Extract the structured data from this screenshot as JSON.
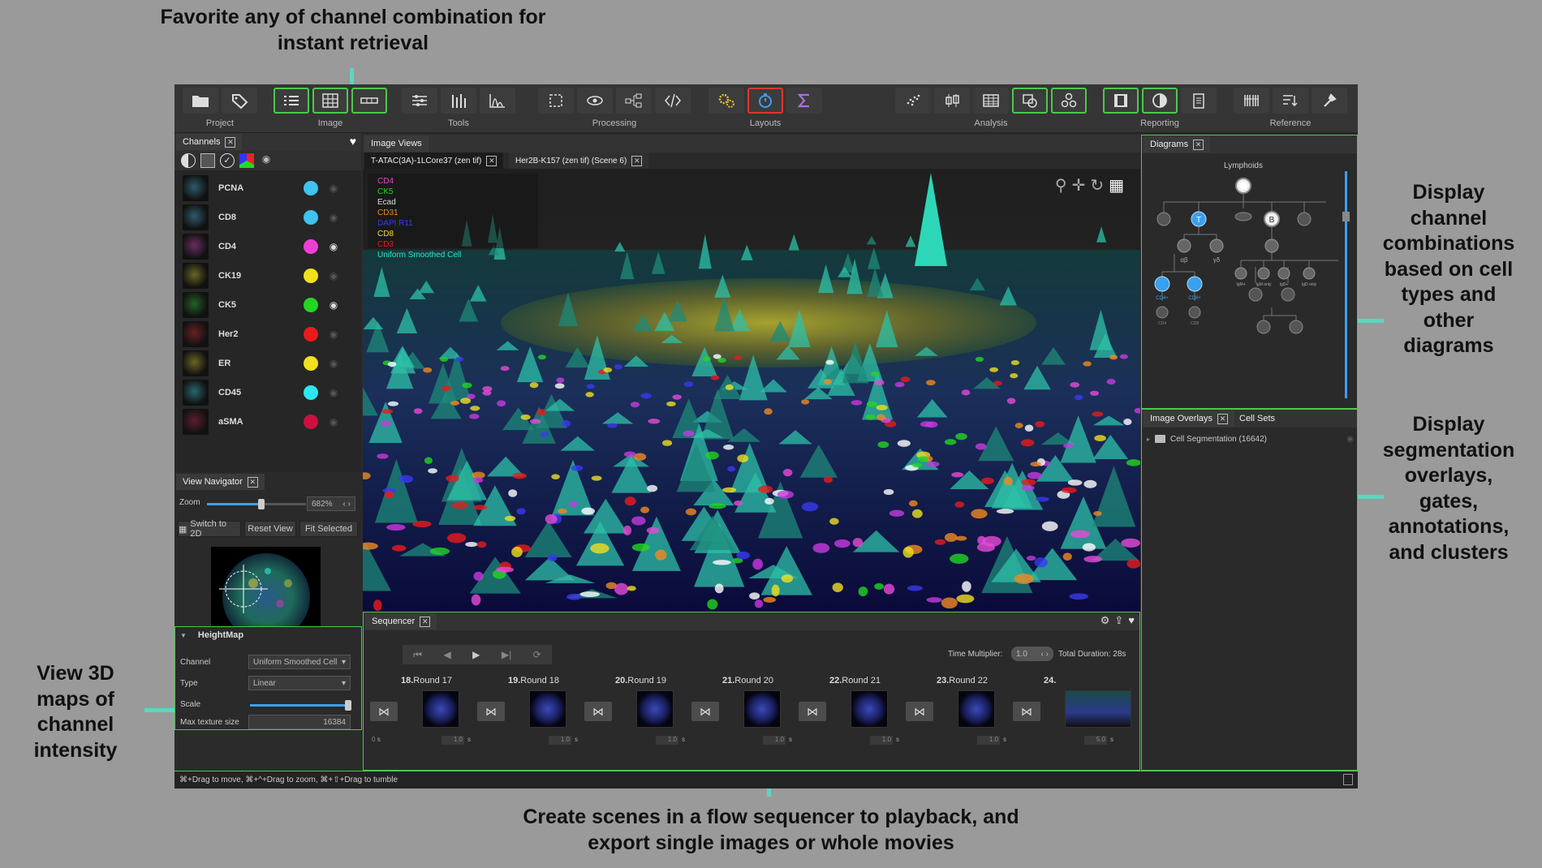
{
  "callouts": {
    "favorite": [
      "Favorite any of channel combination for",
      "instant retrieval"
    ],
    "diagrams": [
      "Display",
      "channel",
      "combinations",
      "based on cell",
      "types and",
      "other",
      "diagrams"
    ],
    "overlays": [
      "Display",
      "segmentation",
      "overlays,",
      "gates,",
      "annotations,",
      "and clusters"
    ],
    "heightmap": [
      "View 3D",
      "maps of",
      "channel",
      "intensity"
    ],
    "sequencer": [
      "Create scenes in a flow sequencer to playback, and",
      "export single images or whole movies"
    ]
  },
  "toolbar": {
    "groups": [
      {
        "label": "Project",
        "icons": [
          "folder-icon",
          "tag-icon"
        ]
      },
      {
        "label": "Image",
        "icons": [
          "channel-list-icon",
          "grid-icon",
          "rect-icon"
        ]
      },
      {
        "label": "Tools",
        "icons": [
          "sliders-icon",
          "columns-icon",
          "histogram-icon"
        ]
      },
      {
        "label": "Processing",
        "icons": [
          "crop-icon",
          "eye-icon",
          "workflow-icon",
          "code-icon"
        ]
      },
      {
        "label": "Layouts",
        "icons": [
          "gears-icon",
          "timer-icon",
          "sigma-icon"
        ]
      },
      {
        "label": "Analysis",
        "icons": [
          "scatter-icon",
          "boxplot-icon",
          "table-icon",
          "gate-icon",
          "cluster-icon"
        ]
      },
      {
        "label": "Reporting",
        "icons": [
          "film-icon",
          "contrast-icon",
          "clipboard-icon"
        ]
      },
      {
        "label": "Reference",
        "icons": [
          "reference-icon",
          "filter-icon",
          "tools-icon"
        ]
      }
    ]
  },
  "channels": {
    "tab": "Channels",
    "items": [
      {
        "name": "PCNA",
        "color": "#3fc3ef",
        "visible": false
      },
      {
        "name": "CD8",
        "color": "#3fc3ef",
        "visible": false
      },
      {
        "name": "CD4",
        "color": "#ef3fd2",
        "visible": true
      },
      {
        "name": "CK19",
        "color": "#f0e020",
        "visible": false
      },
      {
        "name": "CK5",
        "color": "#22d622",
        "visible": true
      },
      {
        "name": "Her2",
        "color": "#e81c1c",
        "visible": false
      },
      {
        "name": "ER",
        "color": "#f0e020",
        "visible": false
      },
      {
        "name": "CD45",
        "color": "#2ee6f0",
        "visible": false
      },
      {
        "name": "aSMA",
        "color": "#cc1040",
        "visible": false
      }
    ]
  },
  "navigator": {
    "tab": "View Navigator",
    "zoom_label": "Zoom",
    "zoom_value": "682%",
    "zoom_level": 0.55,
    "switch_2d": "Switch to 2D",
    "reset_view": "Reset View",
    "fit_selected": "Fit Selected"
  },
  "heightmap": {
    "title": "HeightMap",
    "channel_label": "Channel",
    "channel_value": "Uniform Smoothed Cell",
    "type_label": "Type",
    "type_value": "Linear",
    "scale_label": "Scale",
    "max_texture_label": "Max texture size",
    "max_texture_value": "16384"
  },
  "image_views": {
    "tab": "Image Views",
    "doc_tabs": [
      "T-ATAC(3A)-1LCore37 (zen tif)",
      "Her2B-K157 (zen tif) (Scene 6)"
    ],
    "legend": [
      {
        "text": "CD4",
        "color": "#ef3fd2"
      },
      {
        "text": "CK5",
        "color": "#22d622"
      },
      {
        "text": "Ecad",
        "color": "#dddddd"
      },
      {
        "text": "CD31",
        "color": "#f08a20"
      },
      {
        "text": "DAPI R11",
        "color": "#3a3af0"
      },
      {
        "text": "CD8",
        "color": "#f0e020"
      },
      {
        "text": "CD3",
        "color": "#e81c1c"
      },
      {
        "text": "Uniform Smoothed Cell",
        "color": "#2ee6c8"
      }
    ]
  },
  "sequencer": {
    "tab": "Sequencer",
    "time_multiplier_label": "Time Multiplier:",
    "time_multiplier_value": "1.0",
    "total_duration": "Total Duration: 28s",
    "start_seconds": "0",
    "unit": "s",
    "scenes": [
      {
        "num": "18.",
        "name": "Round 17",
        "duration": "1.0"
      },
      {
        "num": "19.",
        "name": "Round 18",
        "duration": "1.0"
      },
      {
        "num": "20.",
        "name": "Round 19",
        "duration": "1.0"
      },
      {
        "num": "21.",
        "name": "Round 20",
        "duration": "1.0"
      },
      {
        "num": "22.",
        "name": "Round 21",
        "duration": "1.0"
      },
      {
        "num": "23.",
        "name": "Round 22",
        "duration": "1.0"
      },
      {
        "num": "24.",
        "name": "",
        "duration": "5.0"
      }
    ]
  },
  "diagrams": {
    "tab": "Diagrams",
    "title": "Lymphoids",
    "node_labels": [
      "T",
      "B",
      "αβ",
      "γδ",
      "CD4+",
      "CD8+",
      "CD4",
      "CD8",
      "IgM+",
      "IgM only",
      "IgD+",
      "IgD only"
    ]
  },
  "overlays": {
    "tab": "Image Overlays",
    "tab2": "Cell Sets",
    "item": "Cell Segmentation (16642)"
  },
  "statusbar": "⌘+Drag to move, ⌘+^+Drag to zoom, ⌘+⇧+Drag to tumble"
}
